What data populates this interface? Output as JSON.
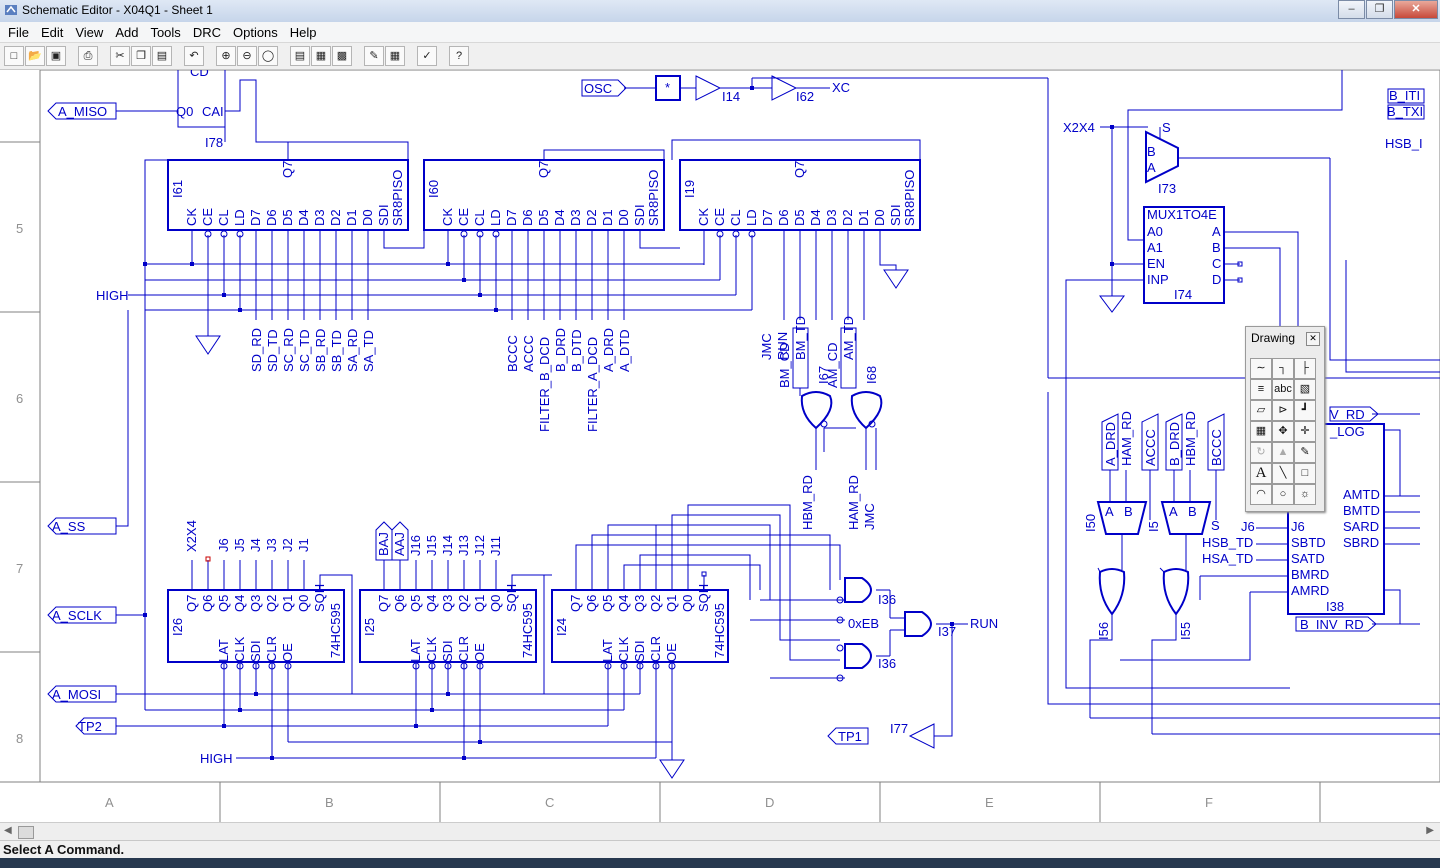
{
  "window": {
    "title": "Schematic Editor - X04Q1 - Sheet 1"
  },
  "menu": [
    "File",
    "Edit",
    "View",
    "Add",
    "Tools",
    "DRC",
    "Options",
    "Help"
  ],
  "toolbar_icons": [
    "new-icon",
    "open-icon",
    "save-icon",
    "print-icon",
    "cut-icon",
    "copy-icon",
    "paste-icon",
    "undo-icon",
    "zoom-in-icon",
    "zoom-out-icon",
    "zoom-fit-icon",
    "hierarchy-up-icon",
    "hierarchy-push-icon",
    "hierarchy-pop-icon",
    "symbol-edit-icon",
    "symbol-new-icon",
    "check-icon",
    "help-icon"
  ],
  "status": "Select A Command.",
  "palette": {
    "title": "Drawing",
    "close": "x",
    "tools": [
      "wire-tool",
      "bus-tool",
      "net-tool",
      "label-tool",
      "text-abc-tool",
      "port-tool",
      "symbol-tool",
      "gate-tool",
      "pin-tool",
      "probe-tool",
      "move-tool",
      "line-tool",
      "rotate-tool",
      "mirror-tool",
      "pencil-tool",
      "text-tool",
      "diagonal-tool",
      "rect-tool",
      "arc-tool",
      "circle-tool",
      "bitmap-tool"
    ],
    "text_glyph": "A",
    "abc": "abc"
  },
  "rows": [
    "5",
    "6",
    "7",
    "8"
  ],
  "cols": [
    "A",
    "B",
    "C",
    "D",
    "E",
    "F"
  ],
  "ports": {
    "a_miso": "A_MISO",
    "a_ss": "A_SS",
    "a_sclk": "A_SCLK",
    "a_mosi": "A_MOSI",
    "tp2": "TP2",
    "tp1": "TP1",
    "osc": "OSC",
    "star": "*",
    "bti": "B_ITI",
    "btx": "B_TXI",
    "vrd": "V_RD",
    "binvrd": "B_INV_RD"
  },
  "labels": {
    "high1": "HIGH",
    "high2": "HIGH",
    "xc": "XC",
    "x2x4": "X2X4",
    "hsb": "HSB_I",
    "run": "RUN",
    "oxeb": "0xEB",
    "cd": "CD",
    "q0": "Q0",
    "cai": "CAI",
    "j6": "J6",
    "x2x4v": "X2X4"
  },
  "inst": {
    "i78": "I78",
    "i14": "I14",
    "i62": "I62",
    "i61": "I61",
    "i60": "I60",
    "i19": "I19",
    "i73": "I73",
    "i74": "I74",
    "i67": "I67",
    "i68": "I68",
    "i26": "I26",
    "i25": "I25",
    "i24": "I24",
    "i36": "I36",
    "i37": "I37",
    "i77": "I77",
    "i50": "I50",
    "i56": "I56",
    "i55": "I55",
    "i38": "I38",
    "ipart": "I5"
  },
  "sr": {
    "name": "SR8PISO",
    "pins": [
      "CK",
      "CE",
      "CL",
      "LD",
      "D7",
      "D6",
      "D5",
      "D4",
      "D3",
      "D2",
      "D1",
      "D0",
      "SDI"
    ],
    "q": "Q7"
  },
  "hc": {
    "name": "74HC595",
    "top": [
      "Q7",
      "Q6",
      "Q5",
      "Q4",
      "Q3",
      "Q2",
      "Q1",
      "Q0",
      "SQH"
    ],
    "bottom": [
      "LAT",
      "CLK",
      "SDI",
      "CLR",
      "OE"
    ]
  },
  "mux": {
    "name": "MUX1TO4E",
    "left": [
      "A0",
      "A1",
      "EN",
      "INP"
    ],
    "right": [
      "A",
      "B",
      "C",
      "D"
    ]
  },
  "mux2": {
    "s": "S",
    "b": "B",
    "a": "A"
  },
  "log": {
    "title": "_LOG",
    "left": [
      "J6",
      "SBTD",
      "SATD",
      "BMRD",
      "AMRD"
    ],
    "right": [
      "AMTD",
      "BMTD",
      "SARD",
      "SBRD"
    ],
    "ext": [
      "J6",
      "HSB_TD",
      "HSA_TD"
    ],
    "s": "S"
  },
  "vert61": [
    "SD_RD",
    "SD_TD",
    "SC_RD",
    "SC_TD",
    "SB_RD",
    "SB_TD",
    "SA_RD",
    "SA_TD"
  ],
  "vert60": [
    "BCCC",
    "ACCC",
    "FILTER_B_DCD",
    "B_DRD",
    "B_DTD",
    "FILTER_A_DCD",
    "A_DRD",
    "A_DTD"
  ],
  "vert19": [
    "JMC",
    "RUN",
    "BM_CD",
    "BM_TD",
    "AM_CD",
    "AM_TD"
  ],
  "vertgate": [
    "HBM_RD",
    "HAM_RD",
    "JMC"
  ],
  "vert26": [
    "X2X4",
    "J6",
    "J5",
    "J4",
    "J3",
    "J2",
    "J1"
  ],
  "vert25": [
    "BAJ",
    "AAJ",
    "J16",
    "J15",
    "J14",
    "J13",
    "J12",
    "J11"
  ],
  "vertright": [
    "A_DRD",
    "HAM_RD",
    "ACCC",
    "B_DRD",
    "HBM_RD",
    "BCCC"
  ],
  "muxAB": [
    "A",
    "B",
    "A",
    "B"
  ]
}
